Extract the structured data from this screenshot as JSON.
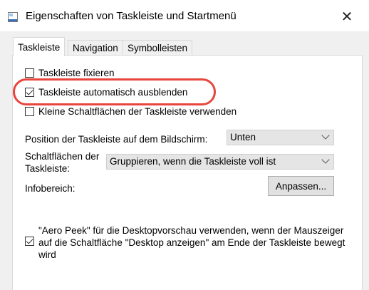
{
  "window": {
    "title": "Eigenschaften von Taskleiste und Startmenü",
    "close_glyph": "✕"
  },
  "tabs": [
    {
      "label": "Taskleiste",
      "active": true
    },
    {
      "label": "Navigation",
      "active": false
    },
    {
      "label": "Symbolleisten",
      "active": false
    }
  ],
  "options": {
    "lock": {
      "label": "Taskleiste fixieren",
      "checked": false
    },
    "autohide": {
      "label": "Taskleiste automatisch ausblenden",
      "checked": true
    },
    "small_buttons": {
      "label": "Kleine Schaltflächen der Taskleiste verwenden",
      "checked": false
    }
  },
  "position": {
    "label": "Position der Taskleiste auf dem Bildschirm:",
    "value": "Unten"
  },
  "buttons_group": {
    "label_line1": "Schaltflächen der",
    "label_line2": "Taskleiste:",
    "value": "Gruppieren, wenn die Taskleiste voll ist"
  },
  "notification_area": {
    "label": "Infobereich:",
    "button_label": "Anpassen..."
  },
  "aero_peek": {
    "checked": true,
    "line1": "\"Aero Peek\" für die Desktopvorschau verwenden, wenn der Mauszeiger",
    "line2": "auf die Schaltfläche \"Desktop anzeigen\" am Ende der Taskleiste bewegt",
    "line3": "wird"
  },
  "colors": {
    "highlight": "#e8453c",
    "window_bg": "#f0f0f0",
    "panel_bg": "#ffffff"
  }
}
